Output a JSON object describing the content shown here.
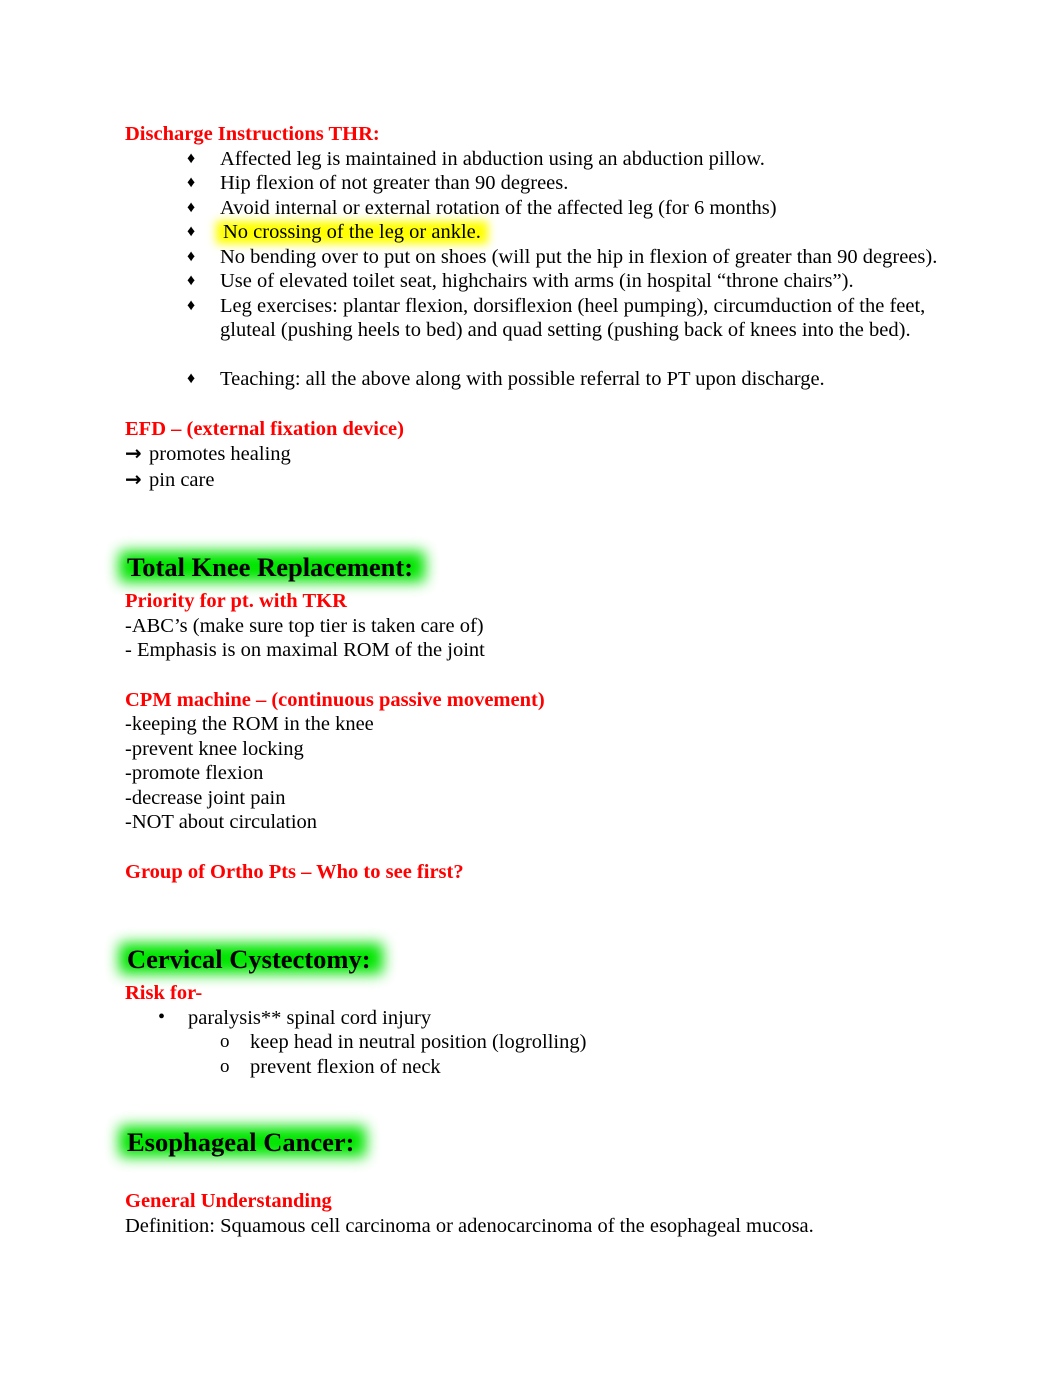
{
  "colors": {
    "heading_red": "#FF0000",
    "highlight_green": "#00E500",
    "highlight_yellow": "#FFFF00",
    "body_text": "#000000",
    "page_background": "#FFFFFF"
  },
  "sections": {
    "thr": {
      "heading": "Discharge Instructions THR:",
      "bullets": [
        {
          "marker": "♦",
          "text": "Affected leg is maintained in abduction using an abduction pillow.",
          "highlight": "none"
        },
        {
          "marker": "♦",
          "text": "Hip flexion of not greater than 90 degrees.",
          "highlight": "none"
        },
        {
          "marker": "♦",
          "text": "Avoid internal or external rotation of the affected leg (for 6 months)",
          "highlight": "none"
        },
        {
          "marker": "♦",
          "text": "No crossing of the leg or ankle.",
          "highlight": "yellow"
        },
        {
          "marker": "♦",
          "text": "No bending over to put on shoes (will put the hip in flexion of greater than 90 degrees).",
          "highlight": "none"
        },
        {
          "marker": "♦",
          "text": "Use of elevated toilet seat, highchairs with arms (in hospital “throne chairs”).",
          "highlight": "none"
        },
        {
          "marker": "♦",
          "text": "Leg exercises: plantar flexion, dorsiflexion (heel pumping), circumduction of the feet, gluteal (pushing heels to bed) and quad setting (pushing back of knees into the bed).",
          "highlight": "none"
        }
      ],
      "teaching_bullet": {
        "marker": "♦",
        "text": "Teaching: all the above along with possible referral to PT upon discharge."
      }
    },
    "efd": {
      "heading": "EFD – (external fixation device)",
      "arrow_glyph": "→",
      "lines": [
        "promotes healing",
        "pin care"
      ]
    },
    "tkr": {
      "heading": "Total Knee Replacement:",
      "subheading": "Priority for pt. with TKR",
      "lines": [
        "-ABC’s (make sure top tier is taken care of)",
        "- Emphasis is on maximal ROM of the joint"
      ],
      "cpm_heading": "CPM machine – (continuous passive movement)",
      "cpm_lines": [
        "-keeping the ROM in the knee",
        "-prevent knee locking",
        "-promote flexion",
        "-decrease joint pain",
        "-NOT about circulation"
      ],
      "ortho_heading": "Group of Ortho Pts – Who to see first?"
    },
    "cervical": {
      "heading": "Cervical Cystectomy:",
      "subheading": "Risk for-",
      "bullets": [
        {
          "marker": "•",
          "text": "paralysis** spinal cord injury"
        }
      ],
      "sub_bullets": [
        {
          "marker": "o",
          "text": "keep head in neutral position (logrolling)"
        },
        {
          "marker": "o",
          "text": "prevent flexion of neck"
        }
      ]
    },
    "esophageal": {
      "heading": "Esophageal Cancer:",
      "subheading": "General Understanding",
      "definition": "Definition: Squamous cell carcinoma or adenocarcinoma of the esophageal mucosa."
    }
  }
}
